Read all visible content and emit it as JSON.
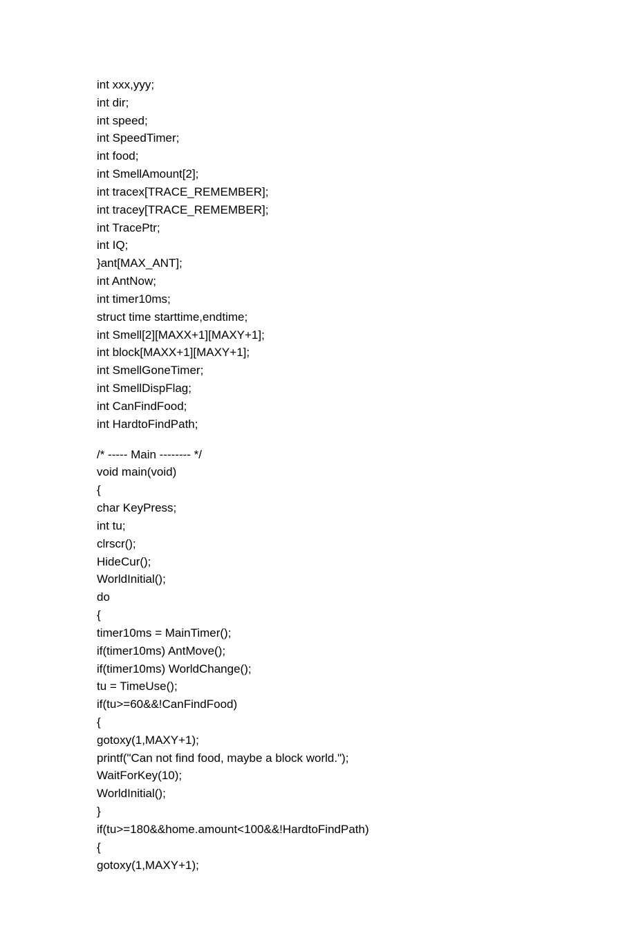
{
  "block1": [
    "int xxx,yyy;",
    "int dir;",
    "int speed;",
    "int SpeedTimer;",
    "int food;",
    "int SmellAmount[2];",
    "int tracex[TRACE_REMEMBER];",
    "int tracey[TRACE_REMEMBER];",
    "int TracePtr;",
    "int IQ;",
    "}ant[MAX_ANT];",
    "int AntNow;",
    "int timer10ms;",
    "struct time starttime,endtime;",
    "int Smell[2][MAXX+1][MAXY+1];",
    "int block[MAXX+1][MAXY+1];",
    "int SmellGoneTimer;",
    "int SmellDispFlag;",
    "int CanFindFood;",
    "int HardtoFindPath;"
  ],
  "block2": [
    "/* ----- Main -------- */",
    "void main(void)",
    "{",
    "char KeyPress;",
    "int tu;",
    "clrscr();",
    "HideCur();",
    "WorldInitial();",
    "do",
    "{",
    "timer10ms = MainTimer();",
    "if(timer10ms) AntMove();",
    "if(timer10ms) WorldChange();",
    "tu = TimeUse();",
    "if(tu>=60&&!CanFindFood)",
    "{",
    "gotoxy(1,MAXY+1);",
    "printf(\"Can not find food, maybe a block world.\");",
    "WaitForKey(10);",
    "WorldInitial();",
    "}",
    "if(tu>=180&&home.amount<100&&!HardtoFindPath)",
    "{",
    "gotoxy(1,MAXY+1);"
  ]
}
